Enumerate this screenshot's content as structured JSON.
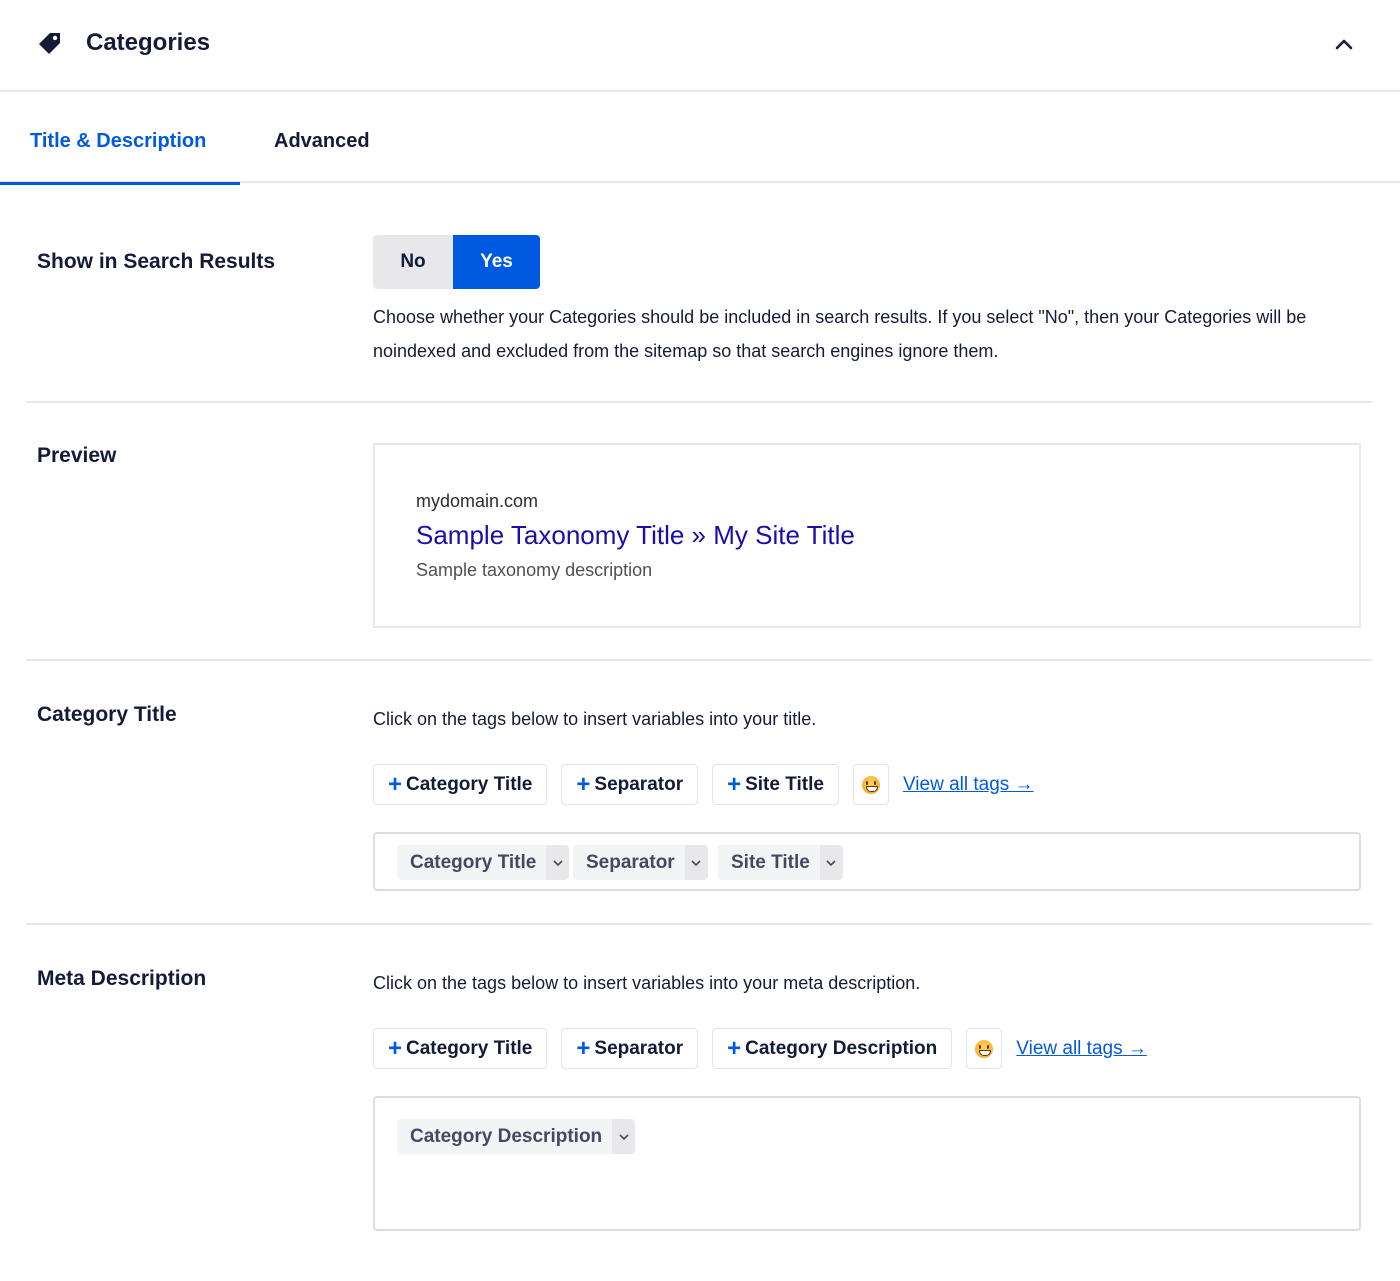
{
  "header": {
    "title": "Categories",
    "icon": "tag-icon",
    "collapse_icon": "chevron-up-icon"
  },
  "tabs": [
    {
      "label": "Title & Description",
      "active": true
    },
    {
      "label": "Advanced",
      "active": false
    }
  ],
  "colors": {
    "accent": "#005ae0",
    "text": "#141b38",
    "preview_link": "#1a0dab",
    "border": "#e8e8eb"
  },
  "search_results": {
    "label": "Show in Search Results",
    "options": [
      "No",
      "Yes"
    ],
    "selected": "Yes",
    "description": "Choose whether your Categories should be included in search results. If you select \"No\", then your Categories will be noindexed and excluded from the sitemap so that search engines ignore them."
  },
  "preview": {
    "label": "Preview",
    "domain": "mydomain.com",
    "title": "Sample Taxonomy Title » My Site Title",
    "description": "Sample taxonomy description"
  },
  "category_title": {
    "label": "Category Title",
    "help": "Click on the tags below to insert variables into your title.",
    "tag_buttons": [
      "Category Title",
      "Separator",
      "Site Title"
    ],
    "view_all": "View all tags →",
    "chips": [
      "Category Title",
      "Separator",
      "Site Title"
    ]
  },
  "meta_description": {
    "label": "Meta Description",
    "help": "Click on the tags below to insert variables into your meta description.",
    "tag_buttons": [
      "Category Title",
      "Separator",
      "Category Description"
    ],
    "view_all": "View all tags →",
    "chips": [
      "Category Description"
    ]
  }
}
